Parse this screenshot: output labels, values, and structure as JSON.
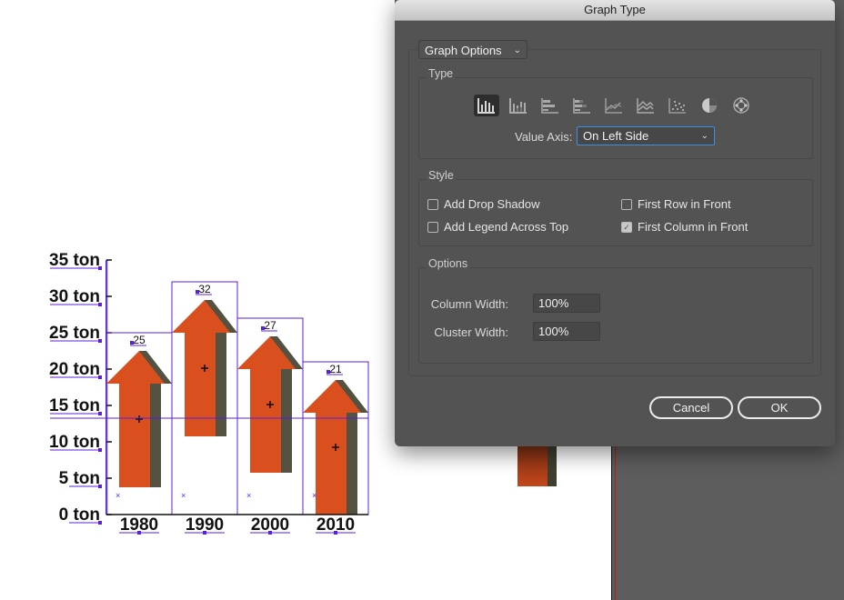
{
  "canvas": {
    "colors": {
      "arrow_face": "#d94f1e",
      "arrow_side": "#53513f",
      "selection": "#5b1fe0",
      "pasteboard": "#5d5d5d"
    }
  },
  "chart_data": {
    "type": "bar",
    "bar_style": "arrow-symbol columns",
    "categories": [
      "1980",
      "1990",
      "2000",
      "2010"
    ],
    "values": [
      25,
      32,
      27,
      21
    ],
    "data_labels": [
      "25",
      "32",
      "27",
      "21"
    ],
    "yticks": [
      "0 ton",
      "5 ton",
      "10 ton",
      "15 ton",
      "20 ton",
      "25 ton",
      "30 ton",
      "35 ton"
    ],
    "ylim": [
      0,
      35
    ],
    "title": "",
    "xlabel": "",
    "ylabel": "",
    "legend": "none",
    "grid": false
  },
  "dialog": {
    "title": "Graph Type",
    "section_select": "Graph Options",
    "type_group": {
      "label": "Type",
      "types": [
        {
          "name": "column-graph-icon",
          "selected": true
        },
        {
          "name": "stacked-column-graph-icon",
          "selected": false
        },
        {
          "name": "bar-graph-icon",
          "selected": false
        },
        {
          "name": "stacked-bar-graph-icon",
          "selected": false
        },
        {
          "name": "line-graph-icon",
          "selected": false
        },
        {
          "name": "area-graph-icon",
          "selected": false
        },
        {
          "name": "scatter-graph-icon",
          "selected": false
        },
        {
          "name": "pie-graph-icon",
          "selected": false
        },
        {
          "name": "radar-graph-icon",
          "selected": false
        }
      ],
      "value_axis_label": "Value Axis:",
      "value_axis_value": "On Left Side"
    },
    "style_group": {
      "label": "Style",
      "checkboxes": [
        {
          "label": "Add Drop Shadow",
          "checked": false
        },
        {
          "label": "Add Legend Across Top",
          "checked": false
        },
        {
          "label": "First Row in Front",
          "checked": false
        },
        {
          "label": "First Column in Front",
          "checked": true
        }
      ]
    },
    "options_group": {
      "label": "Options",
      "column_width_label": "Column Width:",
      "column_width_value": "100%",
      "cluster_width_label": "Cluster Width:",
      "cluster_width_value": "100%"
    },
    "cancel_label": "Cancel",
    "ok_label": "OK"
  }
}
